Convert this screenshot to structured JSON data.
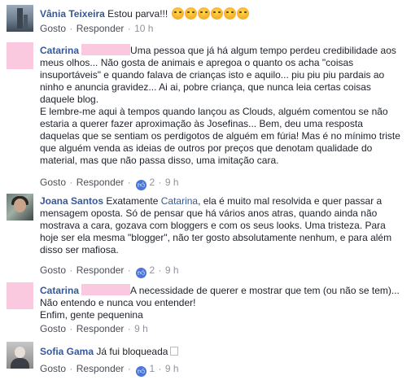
{
  "labels": {
    "like": "Gosto",
    "reply": "Responder",
    "sep": "·"
  },
  "comments": [
    {
      "name": "Vânia Teixeira",
      "text": "Estou parva!!!",
      "emojis": [
        "angry-face-icon",
        "angry-face-icon",
        "angry-face-icon",
        "angry-face-icon",
        "angry-face-icon",
        "angry-face-icon"
      ],
      "time": "10 h"
    },
    {
      "name": "Catarina",
      "paragraphs": [
        "Uma pessoa que já há algum tempo perdeu credibilidade aos meus olhos... Não gosta de animais e apregoa o quanto os acha \"coisas insuportáveis\" e quando falava de crianças isto e aquilo... piu piu piu pardais ao ninho e anuncia gravidez... Ai ai, pobre criança, que nunca leia certas coisas daquele blog.",
        "E lembre-me aqui à tempos quando lançou as Clouds, alguém comentou se não estaria a querer fazer aproximação às Josefinas... Bem, deu uma resposta daquelas que se sentiam os perdigotos de alguém em fúria! Mas é no mínimo triste que alguém venda as ideias de outros por preços que denotam qualidade do material, mas que não passa disso, uma imitação cara."
      ],
      "likes": "2",
      "time": "9 h"
    },
    {
      "name": "Joana Santos",
      "text_before": "Exatamente ",
      "mention": "Catarina",
      "text_after": ", ela é muito mal resolvida e quer passar a mensagem oposta. Só de pensar que há vários anos atras, quando ainda não mostrava a cara, gozava com bloggers e com os seus looks. Uma tristeza. Para hoje ser ela mesma \"blogger\", não ter gosto absolutamente nenhum, e para além disso ser mafiosa.",
      "likes": "2",
      "time": "9 h"
    },
    {
      "name": "Catarina",
      "paragraphs": [
        "A necessidade de querer e mostrar que tem (ou não se tem)... Não entendo e nunca vou entender!",
        "Enfim, gente pequenina"
      ],
      "time": "9 h"
    },
    {
      "name": "Sofia Gama",
      "text": "Já fui bloqueada",
      "likes": "1",
      "time": "9 h"
    }
  ]
}
